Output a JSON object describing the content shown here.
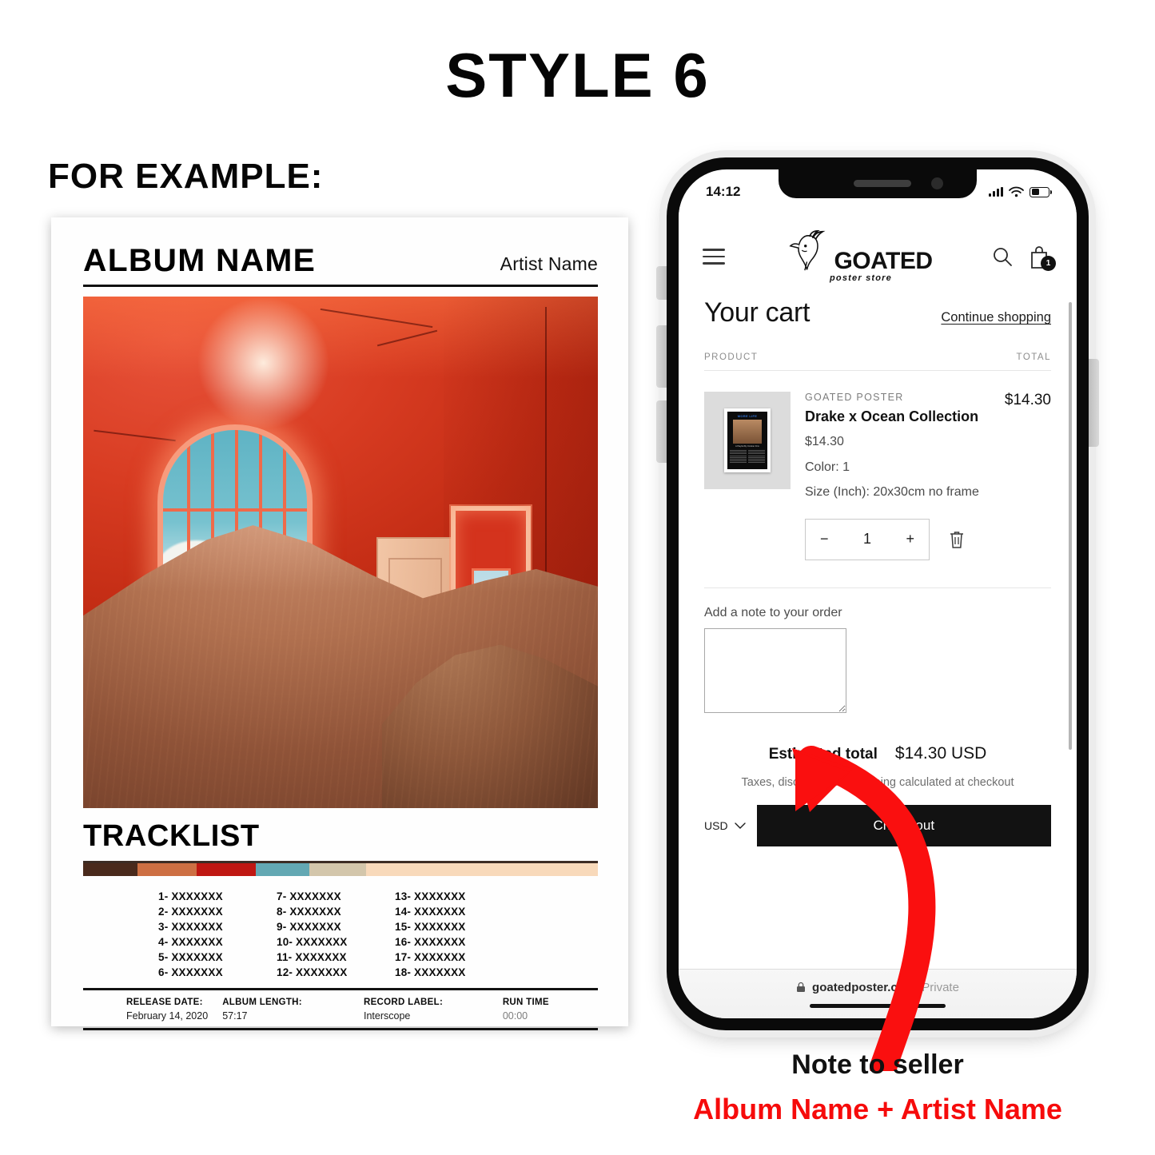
{
  "header": {
    "style_title": "STYLE 6",
    "for_example": "FOR EXAMPLE:"
  },
  "poster": {
    "album_name": "ALBUM NAME",
    "artist_name": "Artist Name",
    "tracklist_title": "TRACKLIST",
    "palette": [
      "#4a2a1c",
      "#cd6f43",
      "#bf1712",
      "#63a8b3",
      "#d3c6ab",
      "#f8d9ba"
    ],
    "tracks_col1": [
      "1- XXXXXXX",
      "2- XXXXXXX",
      "3- XXXXXXX",
      "4- XXXXXXX",
      "5- XXXXXXX",
      "6- XXXXXXX"
    ],
    "tracks_col2": [
      "7- XXXXXXX",
      "8- XXXXXXX",
      "9- XXXXXXX",
      "10- XXXXXXX",
      "11- XXXXXXX",
      "12- XXXXXXX"
    ],
    "tracks_col3": [
      "13- XXXXXXX",
      "14- XXXXXXX",
      "15- XXXXXXX",
      "16- XXXXXXX",
      "17- XXXXXXX",
      "18- XXXXXXX"
    ],
    "meta": {
      "release_date_label": "RELEASE DATE:",
      "release_date_value": "February 14, 2020",
      "album_length_label": "ALBUM LENGTH:",
      "album_length_value": "57:17",
      "record_label_label": "RECORD LABEL:",
      "record_label_value": "Interscope",
      "run_time_label": "RUN TIME",
      "run_time_value": "00:00"
    }
  },
  "phone": {
    "status": {
      "time": "14:12"
    },
    "site_header": {
      "logo_word": "GOATED",
      "logo_sub": "poster store",
      "cart_count": "1"
    },
    "cart": {
      "title": "Your cart",
      "continue_shopping": "Continue shopping",
      "col_product": "PRODUCT",
      "col_total": "TOTAL",
      "item": {
        "vendor": "GOATED POSTER",
        "name": "Drake x Ocean Collection",
        "unit_price": "$14.30",
        "line_total": "$14.30",
        "option_color": "Color: 1",
        "option_size": "Size (Inch): 20x30cm no frame",
        "quantity": "1",
        "minus": "−",
        "plus": "+",
        "thumb_title": "MORE LIFE",
        "thumb_caption": "A Playlist By October Firm",
        "thumb_tracklist_label": "More Life"
      },
      "note_label": "Add a note to your order",
      "note_value": "",
      "estimated_total_label": "Estimated total",
      "estimated_total_value": "$14.30 USD",
      "tax_note": "Taxes, discounts and shipping calculated at checkout",
      "currency": "USD",
      "checkout_label": "Check out"
    },
    "browser": {
      "url": "goatedposter.com",
      "private": "Private"
    }
  },
  "captions": {
    "note_to_seller": "Note to seller",
    "album_artist": "Album Name + Artist Name",
    "accent_color": "#f60b0b"
  }
}
